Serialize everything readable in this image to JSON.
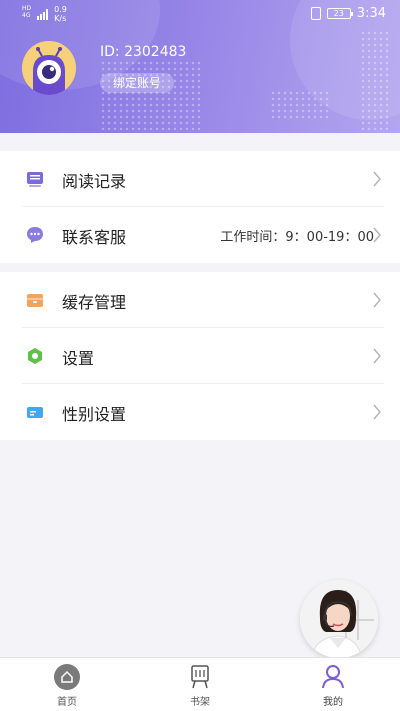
{
  "status_bar": {
    "carrier_line1": "HD",
    "carrier_line2": "4G",
    "speed_value": "0.9",
    "speed_unit": "K/s",
    "battery": "23",
    "time": "3:34"
  },
  "profile": {
    "user_id": "ID: 2302483",
    "bind_account": "绑定账号"
  },
  "menu_group_1": [
    {
      "label": "阅读记录",
      "icon": "reading-history-icon",
      "extra": ""
    },
    {
      "label": "联系客服",
      "icon": "customer-service-icon",
      "extra": "工作时间：9：00-19：00"
    }
  ],
  "menu_group_2": [
    {
      "label": "缓存管理",
      "icon": "cache-icon"
    },
    {
      "label": "设置",
      "icon": "settings-icon"
    },
    {
      "label": "性别设置",
      "icon": "gender-settings-icon"
    }
  ],
  "bottom_nav": {
    "home": "首页",
    "bookshelf": "书架",
    "mine": "我的"
  },
  "colors": {
    "header_gradient_start": "#7d6de0",
    "header_gradient_end": "#b3a6f0",
    "active_tab": "#7a5fd8"
  }
}
